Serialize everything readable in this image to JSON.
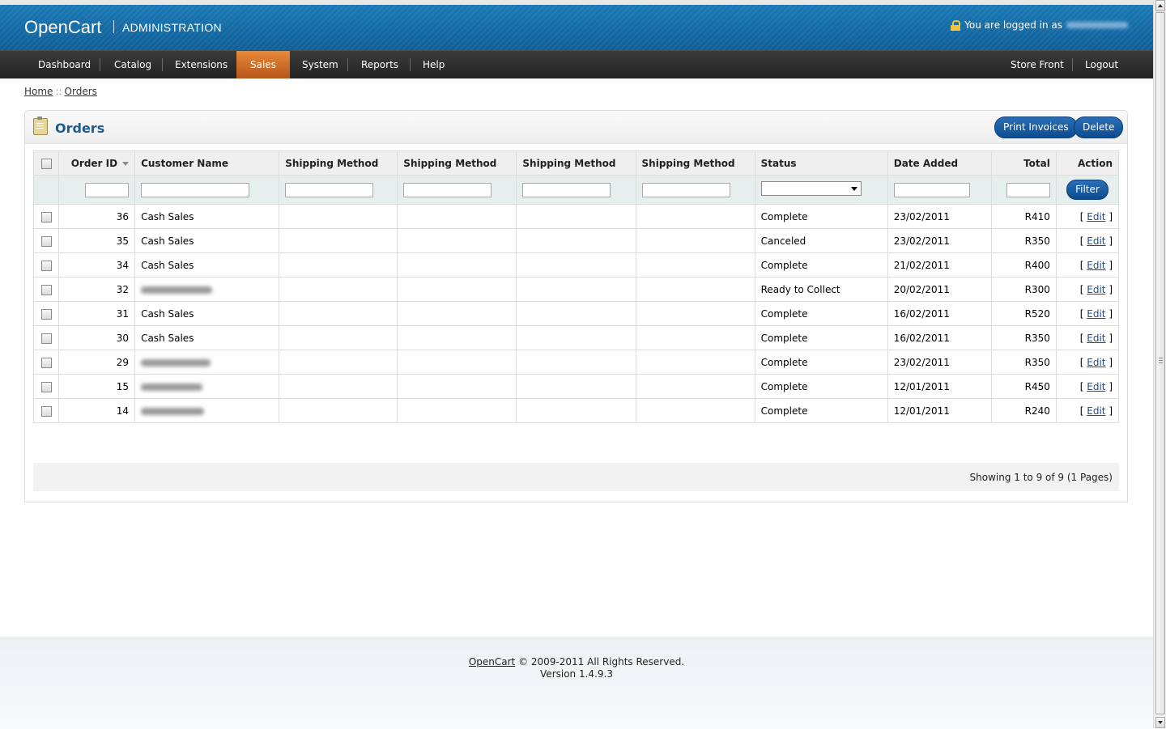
{
  "header": {
    "logo": "OpenCart",
    "subtitle": "ADMINISTRATION",
    "logged_in_text": "You are logged in as"
  },
  "nav": {
    "items": [
      "Dashboard",
      "Catalog",
      "Extensions",
      "Sales",
      "System",
      "Reports",
      "Help"
    ],
    "active": "Sales",
    "right": [
      "Store Front",
      "Logout"
    ]
  },
  "breadcrumb": {
    "home": "Home",
    "separator": "::",
    "current": "Orders"
  },
  "page": {
    "title": "Orders",
    "print_invoices_label": "Print Invoices",
    "delete_label": "Delete"
  },
  "table": {
    "headers": {
      "order_id": "Order ID",
      "customer": "Customer Name",
      "ship1": "Shipping Method",
      "ship2": "Shipping Method",
      "ship3": "Shipping Method",
      "ship4": "Shipping Method",
      "status": "Status",
      "date": "Date Added",
      "total": "Total",
      "action": "Action"
    },
    "filter_label": "Filter",
    "edit_label": "Edit",
    "rows": [
      {
        "id": "36",
        "customer": "Cash Sales",
        "status": "Complete",
        "date": "23/02/2011",
        "total": "R410"
      },
      {
        "id": "35",
        "customer": "Cash Sales",
        "status": "Canceled",
        "date": "23/02/2011",
        "total": "R350"
      },
      {
        "id": "34",
        "customer": "Cash Sales",
        "status": "Complete",
        "date": "21/02/2011",
        "total": "R400"
      },
      {
        "id": "32",
        "customer": "",
        "status": "Ready to Collect",
        "date": "20/02/2011",
        "total": "R300"
      },
      {
        "id": "31",
        "customer": "Cash Sales",
        "status": "Complete",
        "date": "16/02/2011",
        "total": "R520"
      },
      {
        "id": "30",
        "customer": "Cash Sales",
        "status": "Complete",
        "date": "16/02/2011",
        "total": "R350"
      },
      {
        "id": "29",
        "customer": "",
        "status": "Complete",
        "date": "23/02/2011",
        "total": "R350"
      },
      {
        "id": "15",
        "customer": "",
        "status": "Complete",
        "date": "12/01/2011",
        "total": "R450"
      },
      {
        "id": "14",
        "customer": "",
        "status": "Complete",
        "date": "12/01/2011",
        "total": "R240"
      }
    ]
  },
  "pagination": {
    "results": "Showing 1 to 9 of 9 (1 Pages)"
  },
  "footer": {
    "link": "OpenCart",
    "copyright": "© 2009-2011 All Rights Reserved.",
    "version": "Version 1.4.9.3"
  }
}
